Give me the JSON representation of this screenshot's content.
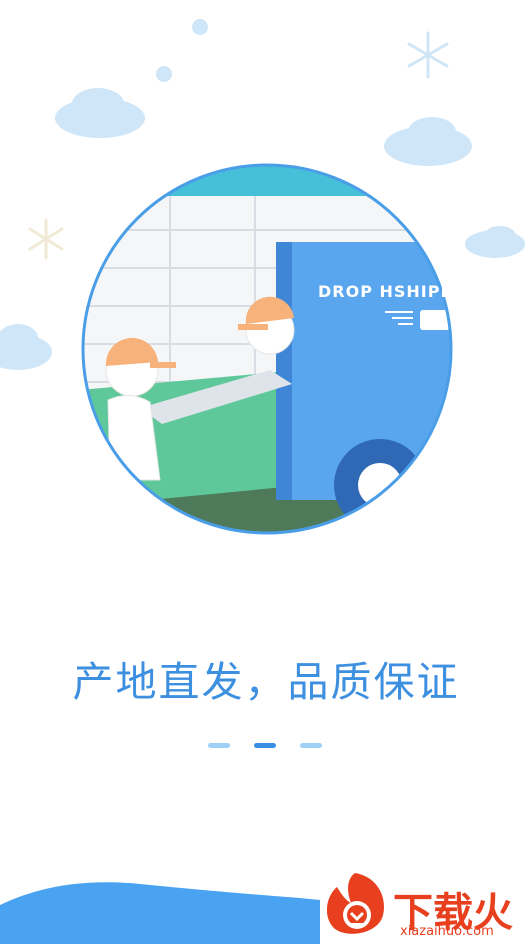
{
  "illustration": {
    "truck_label": "DROP HSHIPP.",
    "description_icon": "delivery-illustration"
  },
  "headline": "产地直发，品质保证",
  "pager": {
    "total": 3,
    "current": 2
  },
  "watermark": {
    "logo_text": "下载火",
    "url": "xiazaihuo.com"
  },
  "colors": {
    "accent": "#3d8fe0",
    "cloud": "#cfe6f8",
    "truck": "#5aa6ee"
  }
}
